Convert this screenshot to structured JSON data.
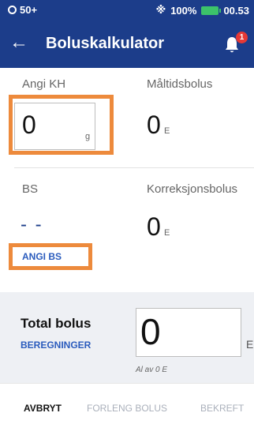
{
  "status_bar": {
    "notification": "50+",
    "battery": "100%",
    "time": "00.53",
    "icons": [
      "circle-icon",
      "bluetooth-icon",
      "battery-icon"
    ]
  },
  "app_bar": {
    "title": "Boluskalkulator",
    "badge_count": "1"
  },
  "carbs": {
    "label": "Angi KH",
    "value": "0",
    "unit": "g"
  },
  "meal_bolus": {
    "label": "Måltidsbolus",
    "value": "0",
    "unit": "E"
  },
  "bg": {
    "label": "BS",
    "value": "- -",
    "link": "ANGI BS"
  },
  "correction_bolus": {
    "label": "Korreksjonsbolus",
    "value": "0",
    "unit": "E"
  },
  "total": {
    "label": "Total bolus",
    "link": "BEREGNINGER",
    "value": "0",
    "unit": "E",
    "note": "Al av 0 E"
  },
  "actions": {
    "cancel": "AVBRYT",
    "extend": "FORLENG BOLUS",
    "confirm": "BEKREFT"
  },
  "colors": {
    "header": "#1c3d8a",
    "link": "#2a5bbd",
    "highlight": "#ed8a3c",
    "summary_bg": "#eef0f4",
    "disabled": "#aab0bb"
  }
}
